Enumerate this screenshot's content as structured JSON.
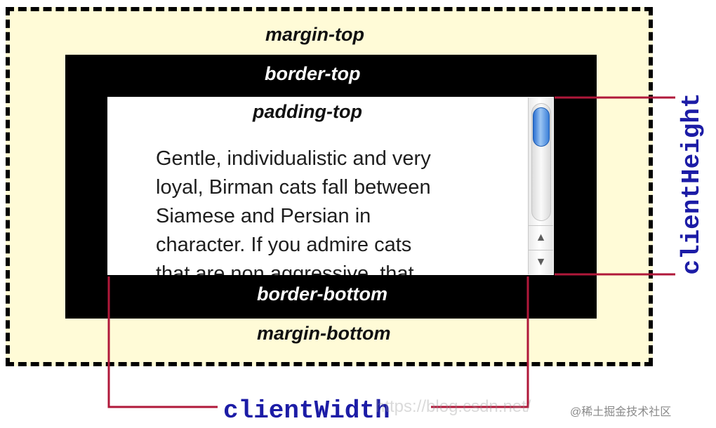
{
  "labels": {
    "margin_top": "margin-top",
    "border_top": "border-top",
    "padding_top": "padding-top",
    "border_bottom": "border-bottom",
    "margin_bottom": "margin-bottom",
    "client_width": "clientWidth",
    "client_height": "clientHeight"
  },
  "content": {
    "lines": [
      "Gentle, individualistic and very",
      "loyal, Birman cats fall between",
      "Siamese and Persian in",
      "character. If you admire cats",
      "that are non aggressive, that"
    ]
  },
  "scrollbar": {
    "up_arrow": "▲",
    "down_arrow": "▼"
  },
  "watermark": {
    "url": "https://blog.csdn.net/",
    "credit": "@稀土掘金技术社区"
  },
  "colors": {
    "margin_fill": "#fffbd7",
    "border_fill": "#000000",
    "measure_line": "#b0183a",
    "measure_label": "#1c1ca6"
  }
}
